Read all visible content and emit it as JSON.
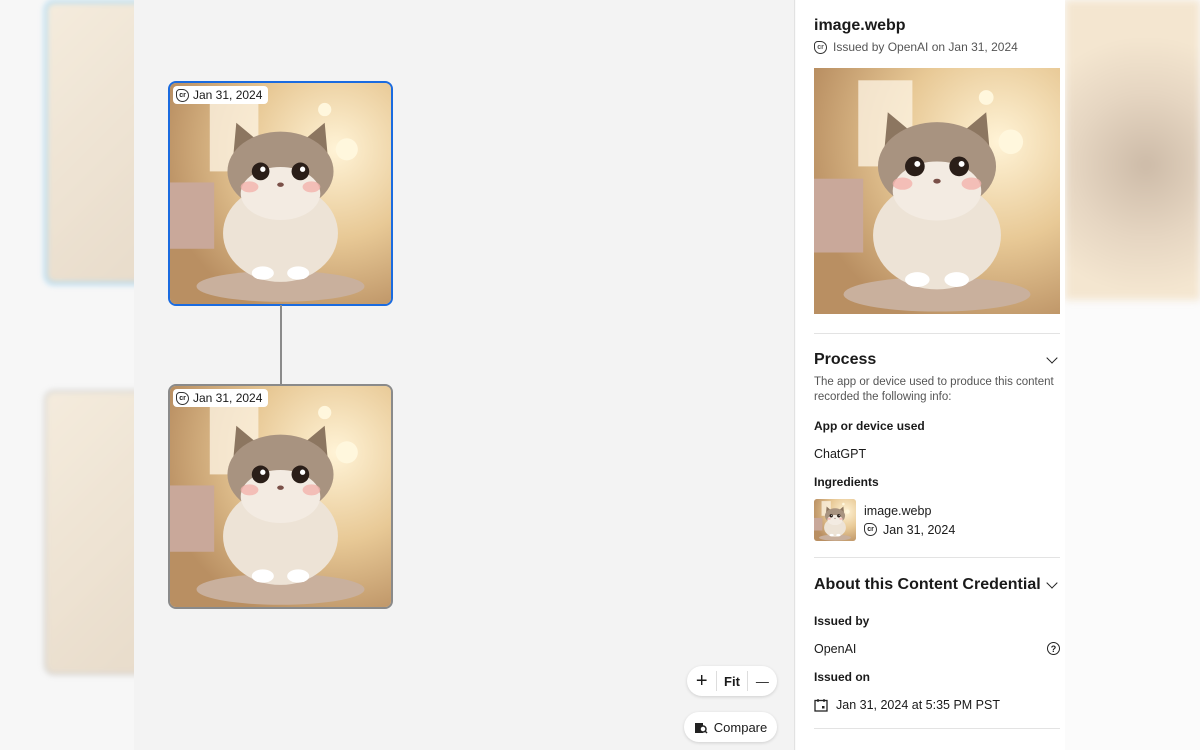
{
  "canvas": {
    "nodes": [
      {
        "date": "Jan 31, 2024",
        "selected": true
      },
      {
        "date": "Jan 31, 2024",
        "selected": false
      }
    ],
    "controls": {
      "zoom_in": "+",
      "fit": "Fit",
      "zoom_out": "—",
      "compare": "Compare"
    }
  },
  "panel": {
    "title": "image.webp",
    "subtitle": "Issued by OpenAI on Jan 31, 2024",
    "process": {
      "heading": "Process",
      "description": "The app or device used to produce this content recorded the following info:",
      "app_label": "App or device used",
      "app_value": "ChatGPT",
      "ingredients_label": "Ingredients",
      "ingredient": {
        "name": "image.webp",
        "date": "Jan 31, 2024"
      }
    },
    "about": {
      "heading": "About this Content Credential",
      "issued_by_label": "Issued by",
      "issued_by": "OpenAI",
      "issued_on_label": "Issued on",
      "issued_on": "Jan 31, 2024 at 5:35 PM PST"
    }
  },
  "colors": {
    "selection": "#1a6be0",
    "canvas": "#f3f3f3"
  }
}
